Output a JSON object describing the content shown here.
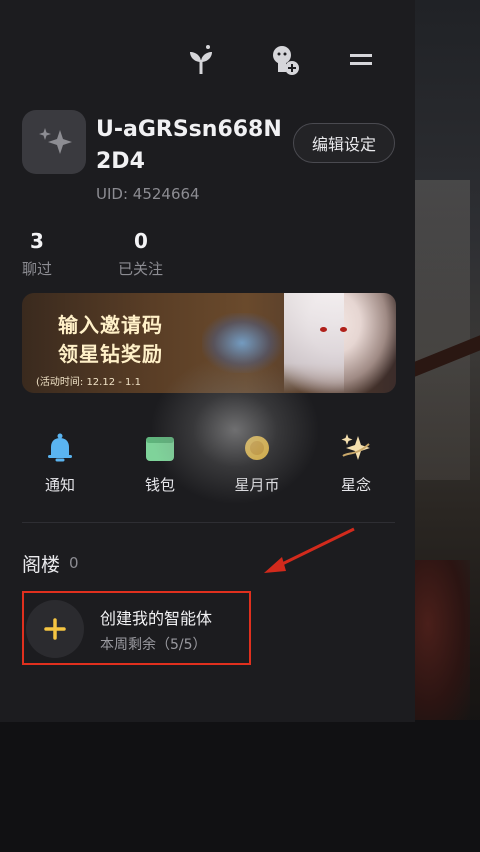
{
  "profile": {
    "username": "U-aGRSsn668N2D4",
    "uid": "UID: 4524664",
    "edit_label": "编辑设定"
  },
  "stats": [
    {
      "value": "3",
      "label": "聊过"
    },
    {
      "value": "0",
      "label": "已关注"
    }
  ],
  "banner": {
    "line1": "输入邀请码",
    "line2": "领星钻奖励",
    "time": "(活动时间: 12.12 - 1.1"
  },
  "shortcuts": [
    {
      "label": "通知",
      "icon": "bell-icon"
    },
    {
      "label": "钱包",
      "icon": "wallet-icon"
    },
    {
      "label": "星月币",
      "icon": "coin-icon"
    },
    {
      "label": "星念",
      "icon": "sparkle-icon"
    }
  ],
  "section": {
    "title": "阁楼",
    "count": "0"
  },
  "create": {
    "title": "创建我的智能体",
    "subtitle": "本周剩余（5/5）"
  },
  "colors": {
    "panel": "#1c1c1f",
    "highlight": "#e0301e",
    "accent_yellow": "#f5c542",
    "bell_blue": "#5ab4f0",
    "wallet_green": "#7fd39a"
  }
}
